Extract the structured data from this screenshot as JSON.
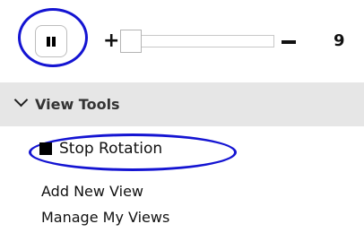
{
  "player": {
    "pause_icon": "pause-icon",
    "zoom_in_label": "+",
    "zoom_out_icon": "minus-icon",
    "zoom_level": "9",
    "accent_color": "#1414d2"
  },
  "view_tools": {
    "title": "View Tools",
    "collapse_icon": "chevron-down-icon",
    "stop_rotation_label": "Stop Rotation",
    "stop_icon": "stop-square-icon",
    "add_view_label": "Add New View",
    "manage_views_label": "Manage My Views"
  }
}
